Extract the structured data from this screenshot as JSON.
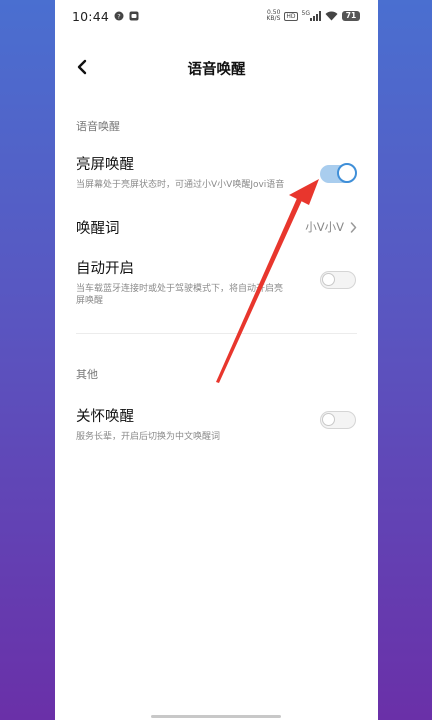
{
  "status_bar": {
    "time": "10:44",
    "speed_value": "0.50",
    "speed_unit": "KB/S",
    "hd": "HD",
    "network": "5G",
    "battery": "71"
  },
  "header": {
    "title": "语音唤醒"
  },
  "section_voice": {
    "label": "语音唤醒",
    "screen_wake": {
      "title": "亮屏唤醒",
      "description": "当屏幕处于亮屏状态时，可通过小V小V唤醒Jovi语音",
      "enabled": true
    },
    "wake_word": {
      "title": "唤醒词",
      "value": "小V小V"
    },
    "auto_on": {
      "title": "自动开启",
      "description": "当车载蓝牙连接时或处于驾驶模式下，将自动开启亮屏唤醒",
      "enabled": false
    }
  },
  "section_other": {
    "label": "其他",
    "care_wake": {
      "title": "关怀唤醒",
      "description": "服务长辈，开启后切换为中文唤醒词",
      "enabled": false
    }
  },
  "colors": {
    "accent": "#3f8fd8",
    "annotation_arrow": "#e8362d"
  }
}
